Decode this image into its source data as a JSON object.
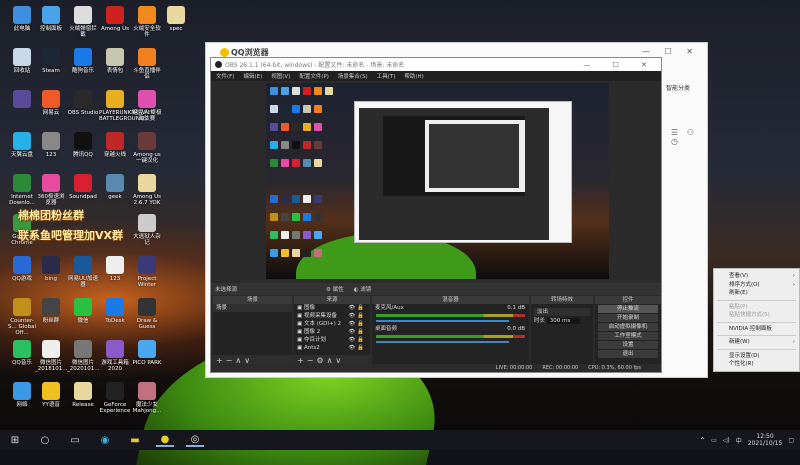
{
  "desktop": {
    "icons": [
      {
        "label": "此电脑",
        "color": "#3d8fe0",
        "col": 0,
        "row": 0
      },
      {
        "label": "控制面板",
        "color": "#4aa3e8",
        "col": 1,
        "row": 0
      },
      {
        "label": "火绒弹窗拦截",
        "color": "#ddd",
        "col": 2,
        "row": 0
      },
      {
        "label": "Among Us",
        "color": "#d02020",
        "col": 3,
        "row": 0
      },
      {
        "label": "火绒安全软件",
        "color": "#f08a1e",
        "col": 4,
        "row": 0
      },
      {
        "label": "spec",
        "color": "#e8d8a0",
        "col": 5,
        "row": 0
      },
      {
        "label": "回收站",
        "color": "#c8d8e8",
        "col": 0,
        "row": 1
      },
      {
        "label": "Steam",
        "color": "#1b2838",
        "col": 1,
        "row": 1
      },
      {
        "label": "酷狗音乐",
        "color": "#1a7be8",
        "col": 2,
        "row": 1
      },
      {
        "label": "表情包",
        "color": "#c8c8b0",
        "col": 3,
        "row": 1
      },
      {
        "label": "斗鱼直播伴侣",
        "color": "#f08020",
        "col": 4,
        "row": 1
      },
      {
        "label": "",
        "color": "#5a4a9a",
        "col": 0,
        "row": 2
      },
      {
        "label": "网易云",
        "color": "#f05a28",
        "col": 1,
        "row": 2
      },
      {
        "label": "OBS Studio",
        "color": "#2a2a2a",
        "col": 2,
        "row": 2
      },
      {
        "label": "PLAYERUNKNOWN'S BATTLEGROUNDS",
        "color": "#e8b020",
        "col": 3,
        "row": 2
      },
      {
        "label": "糖豆人:终极淘汰赛",
        "color": "#e050b0",
        "col": 4,
        "row": 2
      },
      {
        "label": "天翼云盘",
        "color": "#28b0e8",
        "col": 0,
        "row": 3
      },
      {
        "label": "123",
        "color": "#888",
        "col": 1,
        "row": 3
      },
      {
        "label": "腾讯QQ",
        "color": "#111",
        "col": 2,
        "row": 3
      },
      {
        "label": "穿越火线",
        "color": "#c02828",
        "col": 3,
        "row": 3
      },
      {
        "label": "Among us 一键汉化",
        "color": "#6a3a3a",
        "col": 4,
        "row": 3
      },
      {
        "label": "Internet Downlo...",
        "color": "#2a8a3a",
        "col": 0,
        "row": 4
      },
      {
        "label": "360极速浏览器",
        "color": "#e84aa0",
        "col": 1,
        "row": 4
      },
      {
        "label": "Soundpad",
        "color": "#d82030",
        "col": 2,
        "row": 4
      },
      {
        "label": "geek",
        "color": "#5a8ab0",
        "col": 3,
        "row": 4
      },
      {
        "label": "Among Us 2.6.7 YOK",
        "color": "#e8d8a0",
        "col": 4,
        "row": 4
      },
      {
        "label": "Google Chrome",
        "color": "#3a9a40",
        "col": 0,
        "row": 5
      },
      {
        "label": "大逃狱人杂记",
        "color": "#ccc",
        "col": 4,
        "row": 5
      },
      {
        "label": "QQ游戏",
        "color": "#2a6ad8",
        "col": 0,
        "row": 6
      },
      {
        "label": "bing",
        "color": "#2a2a4a",
        "col": 1,
        "row": 6
      },
      {
        "label": "网易UU加速器",
        "color": "#1a5a9a",
        "col": 2,
        "row": 6
      },
      {
        "label": "123",
        "color": "#eee",
        "col": 3,
        "row": 6
      },
      {
        "label": "Project Winter",
        "color": "#3a3a7a",
        "col": 4,
        "row": 6
      },
      {
        "label": "Counter-S... Global Off...",
        "color": "#c0901a",
        "col": 0,
        "row": 7
      },
      {
        "label": "粉丝群",
        "color": "#444",
        "col": 1,
        "row": 7
      },
      {
        "label": "微信",
        "color": "#2ac040",
        "col": 2,
        "row": 7
      },
      {
        "label": "ToDesk",
        "color": "#1a7ae8",
        "col": 3,
        "row": 7
      },
      {
        "label": "Draw & Guess",
        "color": "#333",
        "col": 4,
        "row": 7
      },
      {
        "label": "QQ音乐",
        "color": "#28c060",
        "col": 0,
        "row": 8
      },
      {
        "label": "微信图片_2018101...",
        "color": "#eee",
        "col": 1,
        "row": 8
      },
      {
        "label": "微信图片_2020101...",
        "color": "#777",
        "col": 2,
        "row": 8
      },
      {
        "label": "游戏工具箱 2020",
        "color": "#8a5ac8",
        "col": 3,
        "row": 8
      },
      {
        "label": "PICO PARK",
        "color": "#4aa8f0",
        "col": 4,
        "row": 8
      },
      {
        "label": "网络",
        "color": "#3a9ae8",
        "col": 0,
        "row": 9
      },
      {
        "label": "YY语音",
        "color": "#f0c020",
        "col": 1,
        "row": 9
      },
      {
        "label": "Release",
        "color": "#e8d8a0",
        "col": 2,
        "row": 9
      },
      {
        "label": "GeForce Experience",
        "color": "#222",
        "col": 3,
        "row": 9
      },
      {
        "label": "魔法少女Mahjong...",
        "color": "#c07080",
        "col": 4,
        "row": 9
      }
    ],
    "banner": {
      "line1": "棉棉团粉丝群",
      "line2": "联系鱼吧管理加VX群"
    }
  },
  "browser": {
    "logo": "QQ浏览器",
    "smart_sort": "智能分类",
    "controls": "— ☐ ✕"
  },
  "obs": {
    "title": "OBS 26.1.1 (64-bit, windows) - 配置文件: 未命名 - 场景: 未命名",
    "window_controls": "— ☐ ✕",
    "menu": [
      "文件(F)",
      "编辑(E)",
      "视图(V)",
      "配置文件(P)",
      "场景集合(S)",
      "工具(T)",
      "帮助(H)"
    ],
    "no_source": "未选择源",
    "properties": "属性",
    "filters": "滤镜",
    "scenes": {
      "header": "场景",
      "items": [
        "场景"
      ]
    },
    "sources": {
      "header": "来源",
      "items": [
        "图像",
        "视频采集设备",
        "文本 (GDI+) 2",
        "图像 2",
        "夺目计划",
        "Ants2"
      ]
    },
    "mixer": {
      "header": "混音器",
      "channels": [
        {
          "name": "麦克风/Aux",
          "db": "0.1 dB"
        },
        {
          "name": "桌面音频",
          "db": "0.0 dB"
        }
      ]
    },
    "transitions": {
      "header": "转场特效",
      "type": "淡出",
      "duration_label": "时长",
      "duration": "300 ms"
    },
    "controls": {
      "header": "控件",
      "buttons": [
        "停止推流",
        "开始录制",
        "启动虚拟摄像机",
        "工作室模式",
        "设置",
        "退出"
      ]
    },
    "status": {
      "live": "LIVE: 00:00:00",
      "rec": "REC: 00:00:00",
      "cpu": "CPU: 0.3%, 60.00 fps"
    }
  },
  "context_menu": [
    {
      "label": "查看(V)",
      "sub": true
    },
    {
      "label": "排序方式(O)",
      "sub": true
    },
    {
      "label": "刷新(E)"
    },
    {
      "sep": true
    },
    {
      "label": "粘贴(P)",
      "disabled": true
    },
    {
      "label": "粘贴快捷方式(S)",
      "disabled": true
    },
    {
      "sep": true
    },
    {
      "label": "NVIDIA 控制面板"
    },
    {
      "sep": true
    },
    {
      "label": "新建(W)",
      "sub": true
    },
    {
      "sep": true
    },
    {
      "label": "显示设置(D)"
    },
    {
      "label": "个性化(R)"
    }
  ],
  "taskbar": {
    "time": "12:50",
    "date": "2021/10/15",
    "ime": "中"
  }
}
